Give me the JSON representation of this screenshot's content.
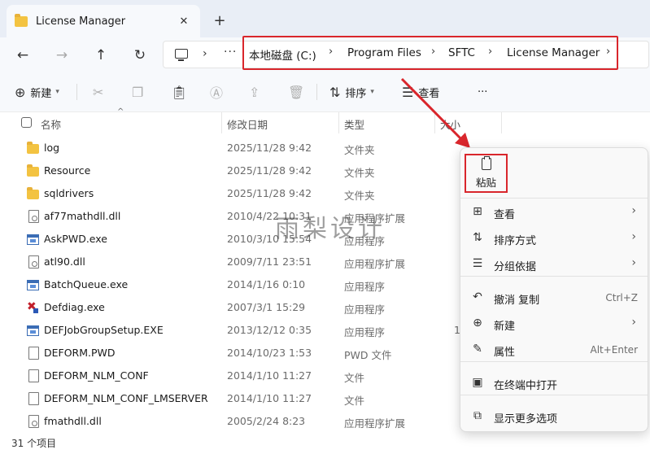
{
  "tab": {
    "title": "License Manager",
    "close": "✕",
    "add": "+"
  },
  "nav": {
    "back": "←",
    "forward": "→",
    "up": "↑",
    "refresh": "↻"
  },
  "address": {
    "overflow": "···",
    "sep": "›",
    "crumbs": [
      "本地磁盘 (C:)",
      "Program Files",
      "SFTC",
      "License Manager"
    ]
  },
  "toolbar": {
    "new_label": "新建",
    "sort_label": "排序",
    "view_label": "查看",
    "more": "···"
  },
  "columns": {
    "name": "名称",
    "date": "修改日期",
    "type": "类型",
    "size": "大小"
  },
  "files": [
    {
      "icon": "folder",
      "name": "log",
      "date": "2025/11/28 9:42",
      "type": "文件夹",
      "size": ""
    },
    {
      "icon": "folder",
      "name": "Resource",
      "date": "2025/11/28 9:42",
      "type": "文件夹",
      "size": ""
    },
    {
      "icon": "folder",
      "name": "sqldrivers",
      "date": "2025/11/28 9:42",
      "type": "文件夹",
      "size": ""
    },
    {
      "icon": "dll",
      "name": "af77mathdll.dll",
      "date": "2010/4/22 10:31",
      "type": "应用程序扩展",
      "size": ""
    },
    {
      "icon": "exe",
      "name": "AskPWD.exe",
      "date": "2010/3/10 15:54",
      "type": "应用程序",
      "size": ""
    },
    {
      "icon": "dll",
      "name": "atl90.dll",
      "date": "2009/7/11 23:51",
      "type": "应用程序扩展",
      "size": ""
    },
    {
      "icon": "exe",
      "name": "BatchQueue.exe",
      "date": "2014/1/16 0:10",
      "type": "应用程序",
      "size": ""
    },
    {
      "icon": "defdiag",
      "name": "Defdiag.exe",
      "date": "2007/3/1 15:29",
      "type": "应用程序",
      "size": ""
    },
    {
      "icon": "exe",
      "name": "DEFJobGroupSetup.EXE",
      "date": "2013/12/12 0:35",
      "type": "应用程序",
      "size": "1"
    },
    {
      "icon": "doc",
      "name": "DEFORM.PWD",
      "date": "2014/10/23 1:53",
      "type": "PWD 文件",
      "size": ""
    },
    {
      "icon": "doc",
      "name": "DEFORM_NLM_CONF",
      "date": "2014/1/10 11:27",
      "type": "文件",
      "size": ""
    },
    {
      "icon": "doc",
      "name": "DEFORM_NLM_CONF_LMSERVER",
      "date": "2014/1/10 11:27",
      "type": "文件",
      "size": ""
    },
    {
      "icon": "dll",
      "name": "fmathdll.dll",
      "date": "2005/2/24 8:23",
      "type": "应用程序扩展",
      "size": ""
    }
  ],
  "status": {
    "count": "31 个项目"
  },
  "watermark": "雨梨设计",
  "context_menu": {
    "paste": "粘贴",
    "items": [
      {
        "icon": "grid-icon",
        "glyph": "⊞",
        "label": "查看",
        "shortcut": "",
        "submenu": true
      },
      {
        "icon": "sort-icon",
        "glyph": "⇅",
        "label": "排序方式",
        "shortcut": "",
        "submenu": true
      },
      {
        "icon": "group-icon",
        "glyph": "☰",
        "label": "分组依据",
        "shortcut": "",
        "submenu": true
      },
      {
        "icon": "undo-icon",
        "glyph": "↶",
        "label": "撤消 复制",
        "shortcut": "Ctrl+Z",
        "submenu": false
      },
      {
        "icon": "new-icon",
        "glyph": "⊕",
        "label": "新建",
        "shortcut": "",
        "submenu": true
      },
      {
        "icon": "wrench-icon",
        "glyph": "✎",
        "label": "属性",
        "shortcut": "Alt+Enter",
        "submenu": false
      },
      {
        "icon": "terminal-icon",
        "glyph": "▣",
        "label": "在终端中打开",
        "shortcut": "",
        "submenu": false
      },
      {
        "icon": "more-options-icon",
        "glyph": "⧉",
        "label": "显示更多选项",
        "shortcut": "",
        "submenu": false
      }
    ],
    "chevron": "›"
  },
  "colors": {
    "highlight_red": "#d9262c",
    "folder": "#f3c341",
    "accent": "#3b6db5"
  }
}
